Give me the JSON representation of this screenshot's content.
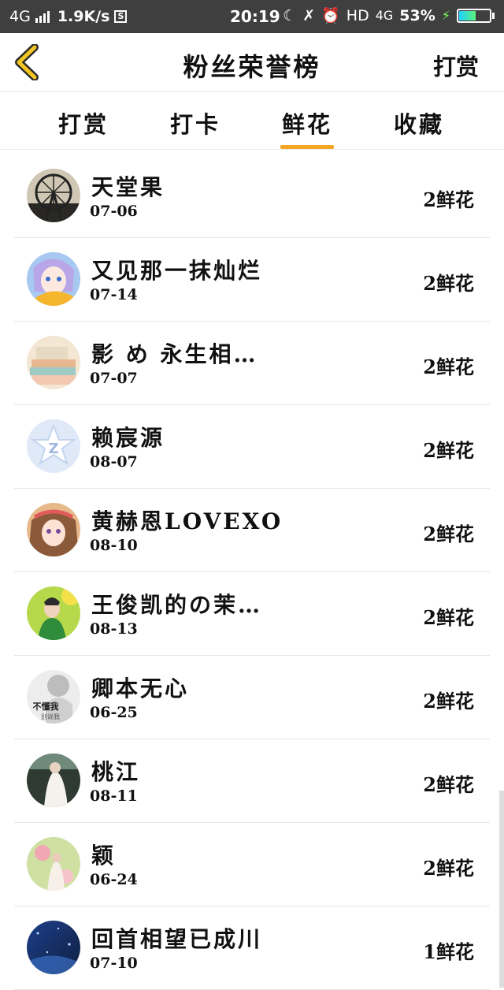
{
  "status_bar": {
    "network": "4G",
    "speed": "1.9K/s",
    "time": "20:19",
    "hd": "HD",
    "net2": "4G",
    "battery": "53%",
    "battery_level": 0.53
  },
  "header": {
    "title": "粉丝荣誉榜",
    "action": "打赏"
  },
  "tabs": [
    {
      "label": "打赏",
      "active": false
    },
    {
      "label": "打卡",
      "active": false
    },
    {
      "label": "鲜花",
      "active": true
    },
    {
      "label": "收藏",
      "active": false
    }
  ],
  "fans": [
    {
      "name": "天堂果",
      "date": "07-06",
      "count": "2鲜花"
    },
    {
      "name": "又见那一抹灿烂",
      "date": "07-14",
      "count": "2鲜花"
    },
    {
      "name": "影 め 永生相…",
      "date": "07-07",
      "count": "2鲜花"
    },
    {
      "name": "赖宸源",
      "date": "08-07",
      "count": "2鲜花"
    },
    {
      "name": "黄赫恩LOVEXO",
      "date": "08-10",
      "count": "2鲜花"
    },
    {
      "name": "王俊凯的の茉…",
      "date": "08-13",
      "count": "2鲜花"
    },
    {
      "name": "卿本无心",
      "date": "06-25",
      "count": "2鲜花"
    },
    {
      "name": "桃江",
      "date": "08-11",
      "count": "2鲜花"
    },
    {
      "name": "颖",
      "date": "06-24",
      "count": "2鲜花"
    },
    {
      "name": "回首相望已成川",
      "date": "07-10",
      "count": "1鲜花"
    }
  ],
  "avatar_text": [
    "不懂我",
    "别说我"
  ],
  "colors": {
    "accent": "#f5a623",
    "back_icon": "#f3c623"
  }
}
